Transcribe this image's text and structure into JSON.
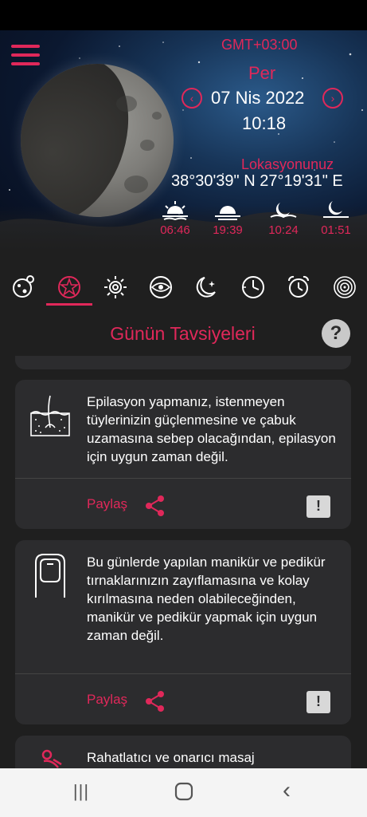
{
  "header": {
    "gmt": "GMT+03:00",
    "day": "Per",
    "date": "07 Nis 2022",
    "time": "10:18",
    "location_label": "Lokasyonunuz",
    "coordinates": "38°30'39\" N 27°19'31\" E",
    "prev_symbol": "‹",
    "next_symbol": "›",
    "sun_moon_times": [
      {
        "icon": "sunrise-icon",
        "time": "06:46"
      },
      {
        "icon": "sunset-icon",
        "time": "19:39"
      },
      {
        "icon": "moonrise-icon",
        "time": "10:24"
      },
      {
        "icon": "moonset-icon",
        "time": "01:51"
      }
    ]
  },
  "tabs": [
    {
      "icon": "planets-icon"
    },
    {
      "icon": "zodiac-star-icon",
      "active": true
    },
    {
      "icon": "sun-spiral-icon"
    },
    {
      "icon": "eye-icon"
    },
    {
      "icon": "moon-stars-icon"
    },
    {
      "icon": "target-clock-icon"
    },
    {
      "icon": "alarm-clock-icon"
    },
    {
      "icon": "galaxy-icon"
    }
  ],
  "section": {
    "title": "Günün Tavsiyeleri",
    "help": "?"
  },
  "cards": [
    {
      "icon": "skin-hair-icon",
      "text": "Epilasyon yapmanız, istenmeyen tüylerinizin güçlenmesine ve çabuk uzamasına sebep olacağından, epilasyon için uygun zaman değil.",
      "share_label": "Paylaş",
      "report": "!"
    },
    {
      "icon": "nail-icon",
      "text": "Bu günlerde yapılan manikür ve pedikür tırnaklarınızın zayıflamasına ve kolay kırılmasına neden olabileceğinden, manikür ve pedikür yapmak için uygun zaman değil.",
      "share_label": "Paylaş",
      "report": "!"
    },
    {
      "icon": "massage-icon",
      "text": "Rahatlatıcı ve onarıcı masaj"
    }
  ],
  "colors": {
    "accent": "#e0285a",
    "background": "#1f1f1f",
    "card": "#2c2c2e"
  },
  "system_nav": {
    "recents": "|||",
    "home": "○",
    "back": "‹"
  }
}
